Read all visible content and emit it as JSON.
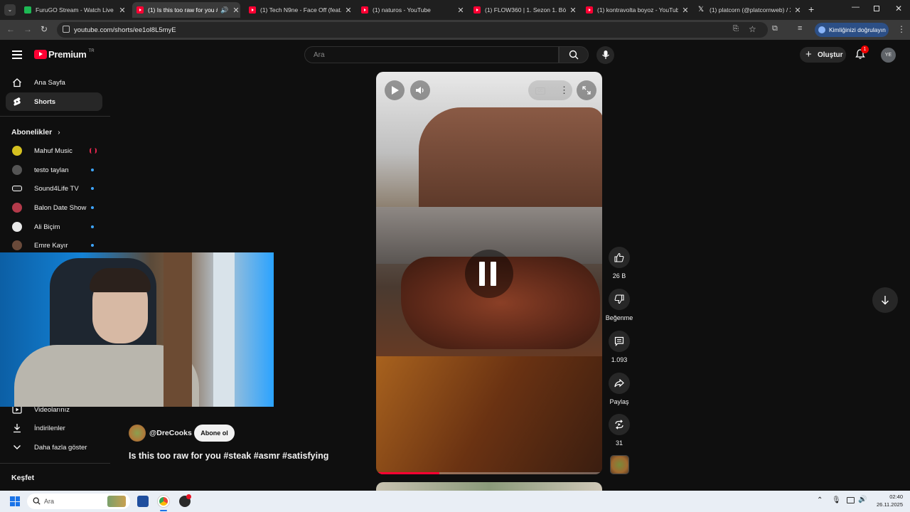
{
  "browser": {
    "tabs": [
      {
        "title": "FuruGO Stream - Watch Live on",
        "favicon": "green-k-icon",
        "active": false
      },
      {
        "title": "(1) Is this too raw for you #",
        "favicon": "youtube-icon",
        "active": true
      },
      {
        "title": "(1) Tech N9ne - Face Off (feat.",
        "favicon": "youtube-icon",
        "active": false
      },
      {
        "title": "(1) naturos - YouTube",
        "favicon": "youtube-icon",
        "active": false
      },
      {
        "title": "(1) FLOW360 | 1. Sezon 1. Bölüm",
        "favicon": "youtube-icon",
        "active": false
      },
      {
        "title": "(1) kontravolta boyoz - YouTube",
        "favicon": "youtube-icon",
        "active": false
      },
      {
        "title": "(1) platcorn (@platcornweb) / X",
        "favicon": "x-icon",
        "active": false
      }
    ],
    "url": "youtube.com/shorts/ee1ol8L5myE",
    "verify_label": "Kimliğinizi doğrulayın"
  },
  "youtube": {
    "logo_text": "Premium",
    "logo_region": "TR",
    "search_placeholder": "Ara",
    "create_label": "Oluştur",
    "notification_count": "1",
    "avatar_initials": "YE"
  },
  "sidebar": {
    "main": [
      {
        "label": "Ana Sayfa",
        "icon": "home-icon"
      },
      {
        "label": "Shorts",
        "icon": "shorts-icon",
        "active": true
      }
    ],
    "subscriptions_title": "Abonelikler",
    "subscriptions": [
      {
        "label": "Mahuf Music",
        "live": true
      },
      {
        "label": "testo taylan"
      },
      {
        "label": "Sound4Life TV"
      },
      {
        "label": "Balon Date Show"
      },
      {
        "label": "Ali Biçim"
      },
      {
        "label": "Emre Kayır"
      }
    ],
    "you": [
      {
        "label": "Videolarınız",
        "icon": "play-square-icon"
      },
      {
        "label": "İndirilenler",
        "icon": "download-icon"
      },
      {
        "label": "Daha fazla göster",
        "icon": "chevron-down-icon"
      }
    ],
    "explore_title": "Keşfet"
  },
  "short": {
    "channel": "@DreCooks",
    "subscribe_label": "Abone ol",
    "title": "Is this too raw for you #steak #asmr #satisfying",
    "progress": 0.28,
    "likes": "26 B",
    "dislike_label": "Beğenme",
    "comments": "1.093",
    "share_label": "Paylaş",
    "remix_count": "31"
  },
  "taskbar": {
    "search_placeholder": "Ara",
    "time": "02:40",
    "date": "26.11.2025"
  }
}
